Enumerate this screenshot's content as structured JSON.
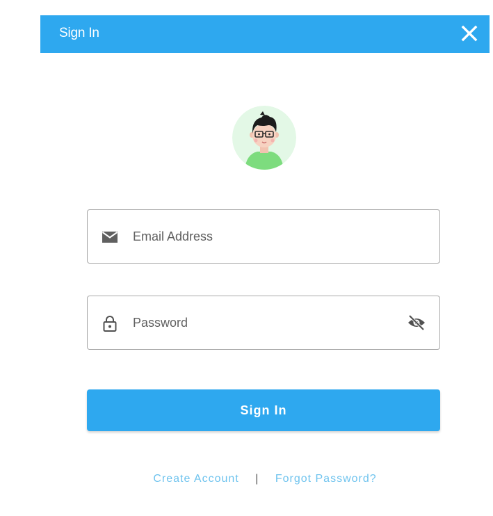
{
  "dialog": {
    "title": "Sign In",
    "close_icon": "close-icon"
  },
  "avatar": {
    "icon": "user-avatar"
  },
  "form": {
    "email": {
      "placeholder": "Email Address",
      "value": "",
      "icon": "mail-icon"
    },
    "password": {
      "placeholder": "Password",
      "value": "",
      "icon": "lock-icon",
      "toggle_icon": "eye-off-icon"
    },
    "submit_label": "Sign In"
  },
  "links": {
    "create_account": "Create Account",
    "separator": "|",
    "forgot_password": "Forgot Password?"
  },
  "colors": {
    "primary": "#2ea8ef",
    "link": "#6ec3ee",
    "avatar_bg": "#e3f8e6",
    "avatar_shirt": "#7ddc7e"
  }
}
